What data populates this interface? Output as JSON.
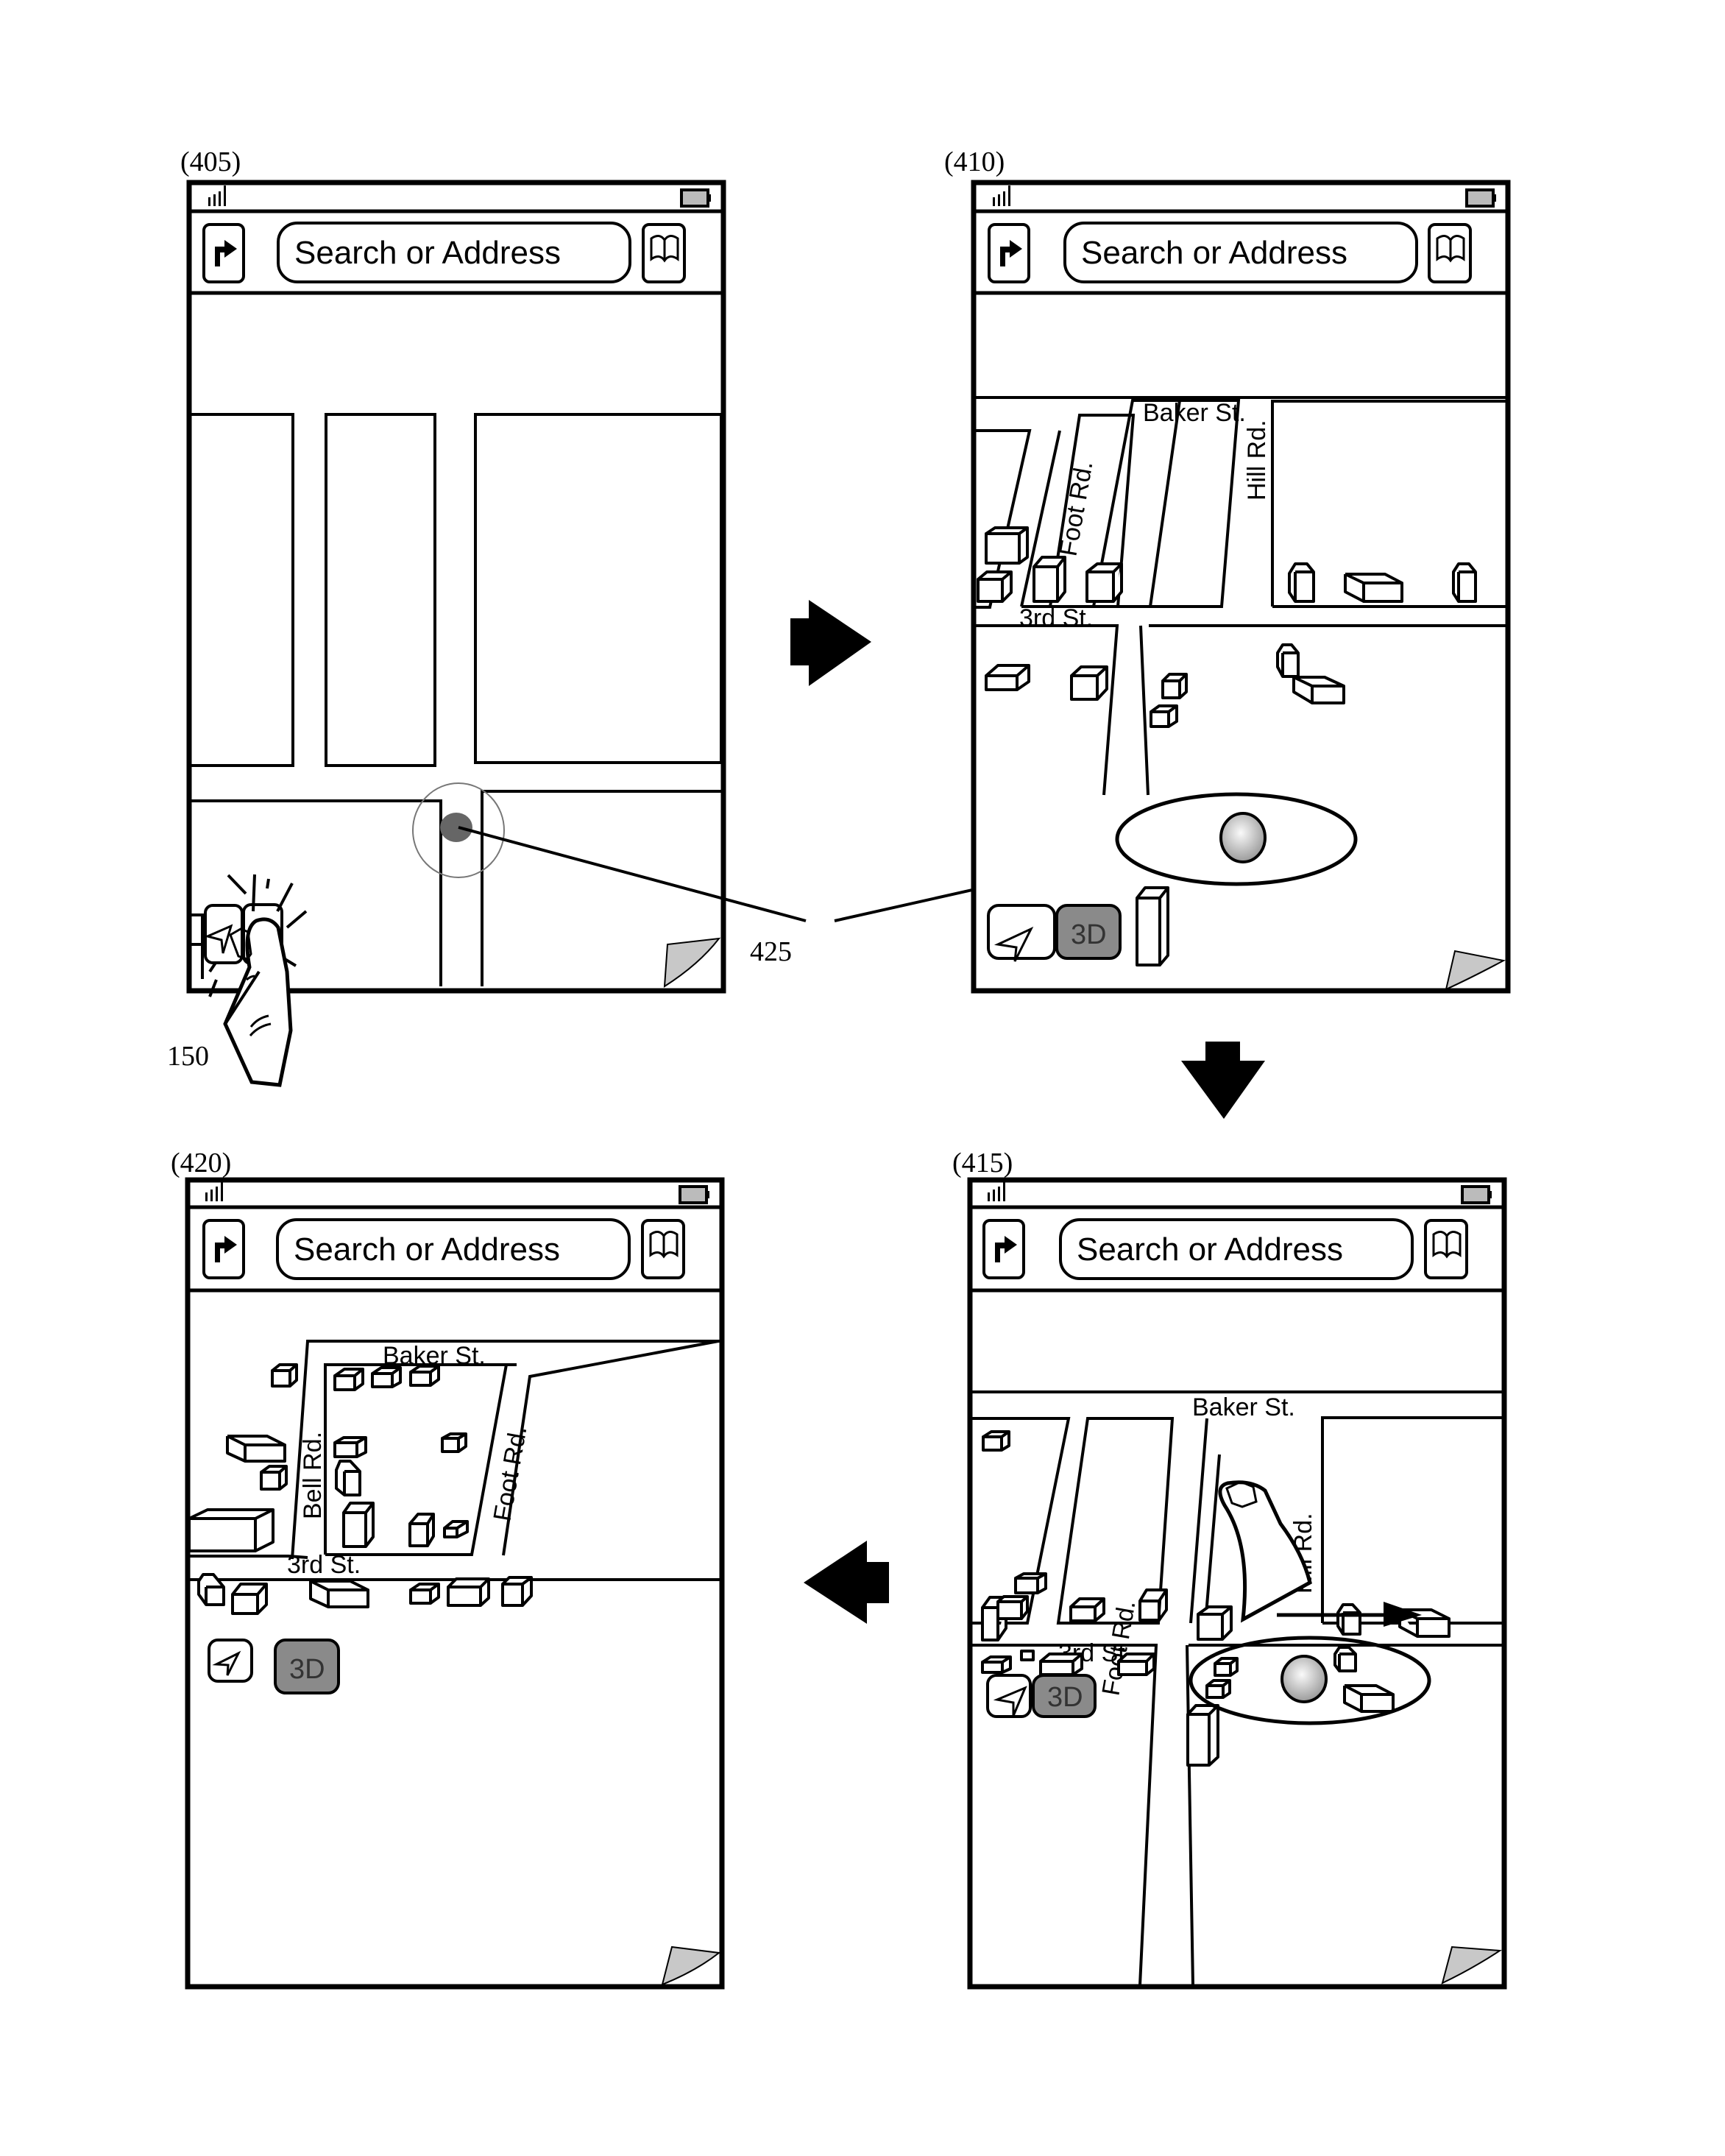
{
  "figure": {
    "panels": [
      {
        "id": "405",
        "label": "(405)",
        "search_placeholder": "Search or Address",
        "mode": "2D",
        "streets": [],
        "controls": {
          "location_button": "location-arrow",
          "toggle_3d_label": "",
          "toggle_3d_pressed": true
        }
      },
      {
        "id": "410",
        "label": "(410)",
        "search_placeholder": "Search or Address",
        "mode": "3D",
        "streets": [
          "Baker St.",
          "Foot Rd.",
          "Hill Rd.",
          "3rd St."
        ],
        "controls": {
          "location_button": "location-arrow",
          "toggle_3d_label": "3D"
        }
      },
      {
        "id": "415",
        "label": "(415)",
        "search_placeholder": "Search or Address",
        "mode": "3D",
        "streets": [
          "Baker St.",
          "Foot Rd.",
          "Hill Rd.",
          "3rd St."
        ],
        "controls": {
          "location_button": "location-arrow",
          "toggle_3d_label": "3D"
        }
      },
      {
        "id": "420",
        "label": "(420)",
        "search_placeholder": "Search or Address",
        "mode": "3D",
        "streets": [
          "Baker St.",
          "Bell Rd.",
          "Foot Rd.",
          "3rd St."
        ],
        "controls": {
          "location_button": "location-arrow",
          "toggle_3d_label": "3D"
        }
      }
    ],
    "reference_numerals": {
      "touch": "150",
      "position_indicator": "425"
    },
    "flow_arrows": [
      "405→410",
      "410→415",
      "415→420"
    ],
    "colors": {
      "line": "#000000",
      "toggle_fill": "#8a8a8a",
      "marker_fill": "#bdbdbd",
      "page_curl": "#c8c8c8"
    }
  }
}
